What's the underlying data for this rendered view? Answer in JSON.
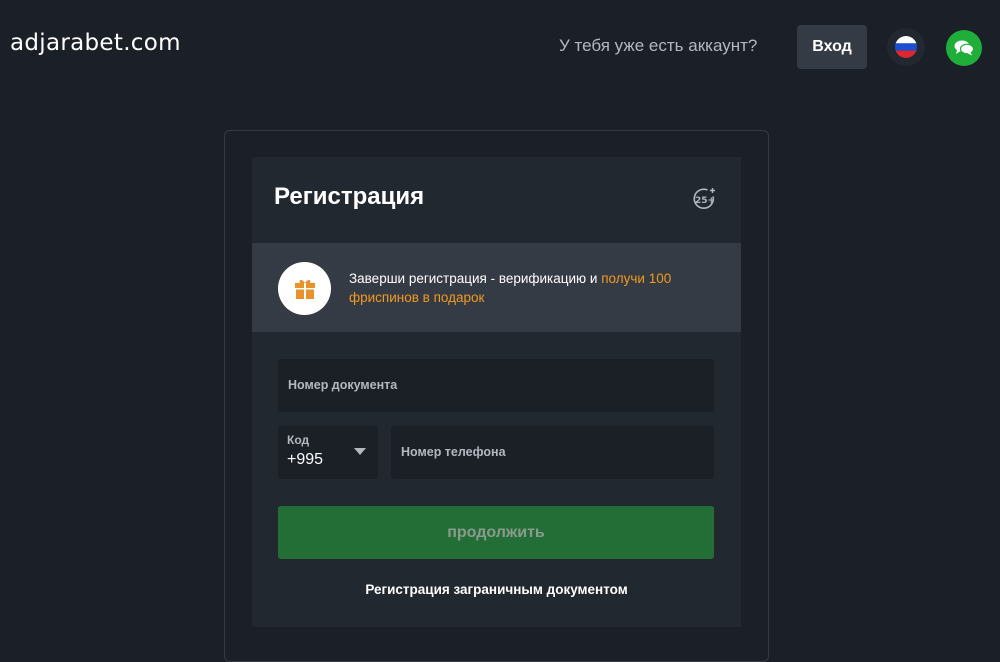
{
  "header": {
    "logo": "adjarabet.com",
    "have_account": "У тебя уже есть аккаунт?",
    "login_label": "Вход",
    "language_icon": "russia-flag-icon",
    "chat_icon": "chat-icon"
  },
  "registration": {
    "title": "Регистрация",
    "age_badge": "25+",
    "promo": {
      "text": "Заверши регистрация - верификацию и ",
      "highlight": "получи 100 фриспинов в подарок",
      "icon": "gift-icon"
    },
    "document_label": "Номер документа",
    "code_label": "Код",
    "code_value": "+995",
    "phone_label": "Номер телефона",
    "continue_label": "продолжить",
    "foreign_doc_link": "Регистрация заграничным документом"
  },
  "colors": {
    "background": "#1b2028",
    "card": "#22282f",
    "promo_bg": "#353b45",
    "accent_orange": "#f29a1e",
    "button_green": "#236e36",
    "chat_green": "#1fae3a"
  }
}
